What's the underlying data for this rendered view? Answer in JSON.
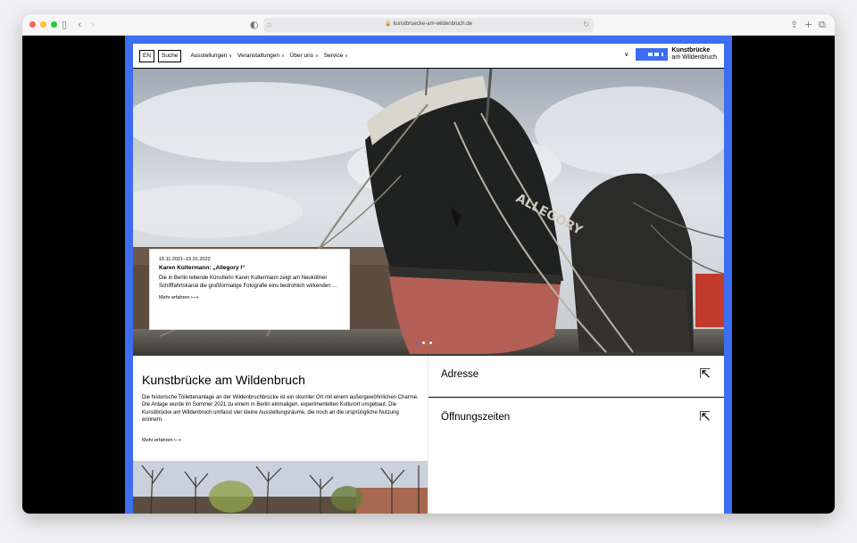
{
  "browser": {
    "url": "kunstbruecke-am-wildenbruch.de",
    "icons": {
      "sidebar": "sidebar-icon",
      "back": "back-icon",
      "forward": "forward-icon",
      "shield": "shield-icon",
      "tab": "tab-icon",
      "reload": "reload-icon",
      "share": "share-icon",
      "new_tab": "plus-icon",
      "tabs": "tabs-icon"
    }
  },
  "nav": {
    "lang": "EN",
    "search": "Suche",
    "items": [
      {
        "label": "Ausstellungen"
      },
      {
        "label": "Veranstaltungen"
      },
      {
        "label": "Über uns"
      },
      {
        "label": "Service"
      }
    ],
    "logo": {
      "line1": "Kunstbrücke",
      "line2": "am Wildenbruch"
    }
  },
  "hero": {
    "date": "15.11.2021–15.01.2022",
    "title": "Karen Koltermann: „Allegory I“",
    "text": "Die in Berlin lebende Künstlerin Karen Koltermann zeigt am Neuköllner Schifffahrtskanal die großformatige Fotografie eins bedrohlich wirkenden ...",
    "more": "Mehr erfahren",
    "ship_name": "ALLEGORY",
    "slides": 3,
    "active_slide": 1
  },
  "about": {
    "title": "Kunstbrücke am Wildenbruch",
    "text": "Die historische Toilettenanlage an der Wildenbruchbrücke ist ein skurriler Ort mit einem außergewöhnlichen Charme. Die Anlage wurde im Sommer 2021 zu einem in Berlin einmaligen, experimentellen Kulturort umgebaut. Die Kunstbrücke am Wildenbruch umfasst vier kleine Ausstellungsräume, die noch an die ursprüngliche Nutzung erinnern.",
    "more": "Mehr erfahren"
  },
  "info": [
    {
      "label": "Adresse"
    },
    {
      "label": "Öffnungszeiten"
    }
  ],
  "colors": {
    "accent": "#3b6ef0",
    "background": "#000000"
  }
}
